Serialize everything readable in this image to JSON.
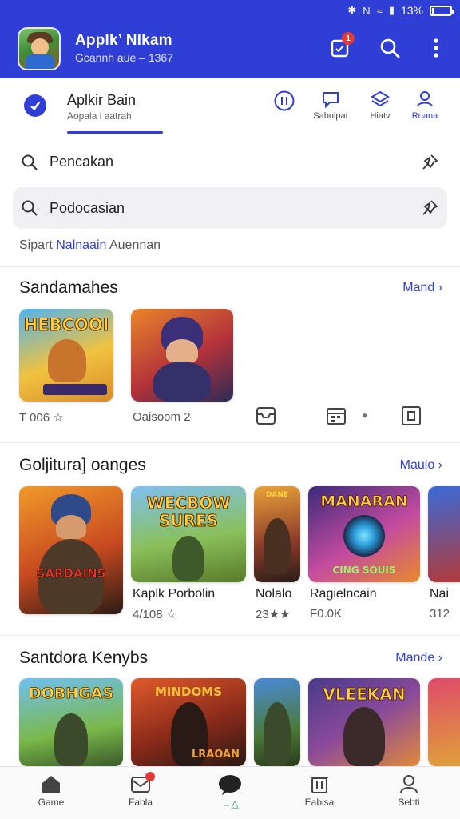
{
  "status_bar": {
    "signal_label": "N",
    "battery": "13%",
    "battery_level": 0.13
  },
  "header": {
    "title": "Applk’ Nlkam",
    "subtitle": "Gcannh aue – 1367",
    "notification_count": "1"
  },
  "tabs": {
    "main_title": "Aplkir Bain",
    "main_subtitle": "Aopala l aatrah",
    "items": [
      {
        "label": ""
      },
      {
        "label": "Sabulpat"
      },
      {
        "label": "Hiatv"
      },
      {
        "label": "Roana"
      }
    ]
  },
  "search": {
    "primary_value": "Pencakan",
    "secondary_value": "Podocasian",
    "suggest_prefix": "Sipart",
    "suggest_highlight": "Nalnaain",
    "suggest_suffix": "Auennan"
  },
  "sections": [
    {
      "title": "Sandamahes",
      "more": "Mand",
      "cards": [
        {
          "art_text": "HEBCOOI",
          "meta": "T 006"
        },
        {
          "art_text": "",
          "meta": "Oaisoom 2"
        }
      ]
    },
    {
      "title": "Goljitura] oanges",
      "more": "Mauio",
      "cards": [
        {
          "art_text": "SARDAINS",
          "title": "",
          "meta": ""
        },
        {
          "art_text": "WECBOW SURES",
          "title": "Kaplk Porbolin",
          "meta": "4/108"
        },
        {
          "art_text": "DANE",
          "title": "Nolalo",
          "meta": "23"
        },
        {
          "art_text": "MANARAN",
          "art_sub": "CING SOUIS",
          "title": "Ragielncain",
          "meta": "F0.0K"
        },
        {
          "art_text": "",
          "title": "Nai",
          "meta": "312"
        }
      ]
    },
    {
      "title": "Santdora Kenybs",
      "more": "Mande",
      "cards": [
        {
          "art_text": "DOBHGAS"
        },
        {
          "art_text": "MINDOMS",
          "art_sub": "LRAOAN"
        },
        {
          "art_text": ""
        },
        {
          "art_text": "VLEEKAN"
        },
        {
          "art_text": ""
        }
      ]
    }
  ],
  "bottom_nav": [
    {
      "label": "Game"
    },
    {
      "label": "Fabla"
    },
    {
      "label": "→△"
    },
    {
      "label": "Eabisa"
    },
    {
      "label": "Sebti"
    }
  ],
  "colors": {
    "accent": "#2f3fd6",
    "badge": "#e53935"
  }
}
